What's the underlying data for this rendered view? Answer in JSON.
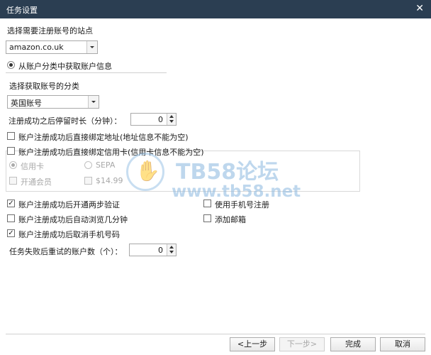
{
  "window": {
    "title": "任务设置"
  },
  "site": {
    "label": "选择需要注册账号的站点",
    "selected": "amazon.co.uk"
  },
  "source_option": {
    "label": "从账户分类中获取账户信息",
    "checked": true
  },
  "category": {
    "label": "选择获取账号的分类",
    "selected": "英国账号"
  },
  "stay_duration": {
    "label": "注册成功之后停留时长（分钟）：",
    "value": "0"
  },
  "checkboxes": {
    "bind_address": {
      "label": "账户注册成功后直接绑定地址(地址信息不能为空)",
      "checked": false
    },
    "bind_card": {
      "label": "账户注册成功后直接绑定信用卡(信用卡信息不能为空)",
      "checked": false
    },
    "two_step": {
      "label": "账户注册成功后开通两步验证",
      "checked": true
    },
    "auto_browse": {
      "label": "账户注册成功后自动浏览几分钟",
      "checked": false
    },
    "cancel_phone": {
      "label": "账户注册成功后取消手机号码",
      "checked": true
    },
    "use_phone": {
      "label": "使用手机号注册",
      "checked": false
    },
    "add_email": {
      "label": "添加邮箱",
      "checked": false
    }
  },
  "card_group": {
    "radio_credit": "信用卡",
    "radio_sepa": "SEPA",
    "check_member": "开通会员",
    "check_price": "$14.99"
  },
  "retry": {
    "label": "任务失败后重试的账户数（个）：",
    "value": "0"
  },
  "watermark": {
    "title": "TB58论坛",
    "url": "www.tb58.net"
  },
  "buttons": {
    "prev": "<上一步",
    "next": "下一步>",
    "finish": "完成",
    "cancel": "取消"
  }
}
